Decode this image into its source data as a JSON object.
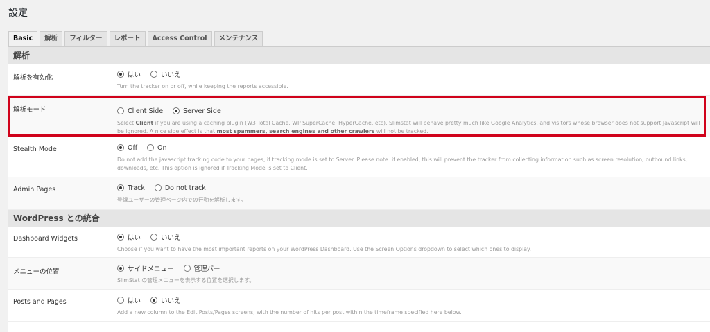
{
  "page_title": "設定",
  "tabs": [
    {
      "label": "Basic",
      "active": true
    },
    {
      "label": "解析"
    },
    {
      "label": "フィルター"
    },
    {
      "label": "レポート"
    },
    {
      "label": "Access Control"
    },
    {
      "label": "メンテナンス"
    }
  ],
  "sections": [
    {
      "title": "解析",
      "rows": [
        {
          "label": "解析を有効化",
          "options": [
            "はい",
            "いいえ"
          ],
          "selected": 0,
          "description": "Turn the tracker on or off, while keeping the reports accessible."
        },
        {
          "label": "解析モード",
          "options": [
            "Client Side",
            "Server Side"
          ],
          "selected": 1,
          "description_parts": [
            "Select ",
            "Client",
            " if you are using a caching plugin (W3 Total Cache, WP SuperCache, HyperCache, etc). Slimstat will behave pretty much like Google Analytics, and visitors whose browser does not support Javascript will be ignored. A nice side effect is that ",
            "most spammers, search engines and other crawlers",
            " will not be tracked."
          ],
          "highlighted": true
        },
        {
          "label": "Stealth Mode",
          "options": [
            "Off",
            "On"
          ],
          "selected": 0,
          "description": "Do not add the javascript tracking code to your pages, if tracking mode is set to Server. Please note: if enabled, this will prevent the tracker from collecting information such as screen resolution, outbound links, downloads, etc. This option is ignored if Tracking Mode is set to Client."
        },
        {
          "label": "Admin Pages",
          "options": [
            "Track",
            "Do not track"
          ],
          "selected": 0,
          "description": "登録ユーザーの管理ページ内での行動を解析します。"
        }
      ]
    },
    {
      "title": "WordPress との統合",
      "rows": [
        {
          "label": "Dashboard Widgets",
          "options": [
            "はい",
            "いいえ"
          ],
          "selected": 0,
          "description": "Choose if you want to have the most important reports on your WordPress Dashboard. Use the Screen Options dropdown to select which ones to display."
        },
        {
          "label": "メニューの位置",
          "options": [
            "サイドメニュー",
            "管理バー"
          ],
          "selected": 0,
          "description": "SlimStat の管理メニューを表示する位置を選択します。"
        },
        {
          "label": "Posts and Pages",
          "options": [
            "はい",
            "いいえ"
          ],
          "selected": 1,
          "description": "Add a new column to the Edit Posts/Pages screens, with the number of hits per post within the timeframe specified here below."
        }
      ]
    }
  ],
  "colors": {
    "highlight": "#d0021b",
    "section_bg": "#e5e5e5"
  }
}
